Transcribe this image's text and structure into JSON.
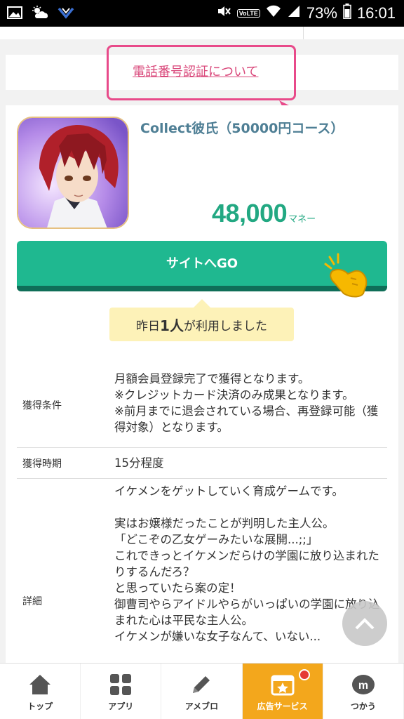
{
  "status_bar": {
    "battery": "73%",
    "time": "16:01",
    "volte": "VoLTE",
    "left_icons": [
      "image-icon",
      "weather-icon",
      "app-icon"
    ],
    "right_icons": [
      "mute-icon",
      "wifi-icon",
      "signal-icon",
      "battery-icon"
    ]
  },
  "phone_auth": {
    "link": "電話番号認証について"
  },
  "offer": {
    "title": "Collect彼氏（50000円コース）",
    "reward_value": "48,000",
    "reward_unit": "マネー",
    "go_button": "サイトへGO",
    "users_prefix": "昨日",
    "users_count": "1人",
    "users_suffix": "が利用しました"
  },
  "details": [
    {
      "label": "獲得条件",
      "value": "月額会員登録完了で獲得となります。\n※クレジットカード決済のみ成果となります。\n※前月までに退会されている場合、再登録可能（獲得対象）となります。"
    },
    {
      "label": "獲得時期",
      "value": "15分程度"
    },
    {
      "label": "詳細",
      "value": "イケメンをゲットしていく育成ゲームです。\n\n実はお嬢様だったことが判明した主人公。\n「どこぞの乙女ゲーみたいな展開...;;」\nこれできっとイケメンだらけの学園に放り込まれたりするんだろ？\nと思っていたら案の定！\n御曹司やらアイドルやらがいっぱいの学園に放り込まれた心は平民な主人公。\nイケメンが嫌いな女子なんて、いない..."
    }
  ],
  "bottom_nav": [
    {
      "label": "トップ",
      "icon": "home-icon"
    },
    {
      "label": "アプリ",
      "icon": "apps-grid-icon"
    },
    {
      "label": "アメブロ",
      "icon": "pencil-icon"
    },
    {
      "label": "広告サービス",
      "icon": "ad-service-star-icon",
      "active": true
    },
    {
      "label": "つかう",
      "icon": "money-m-icon"
    }
  ],
  "colors": {
    "accent_green": "#1fb890",
    "reward_green": "#22a882",
    "link_pink": "#d9477a",
    "nav_active": "#f3a71c"
  }
}
